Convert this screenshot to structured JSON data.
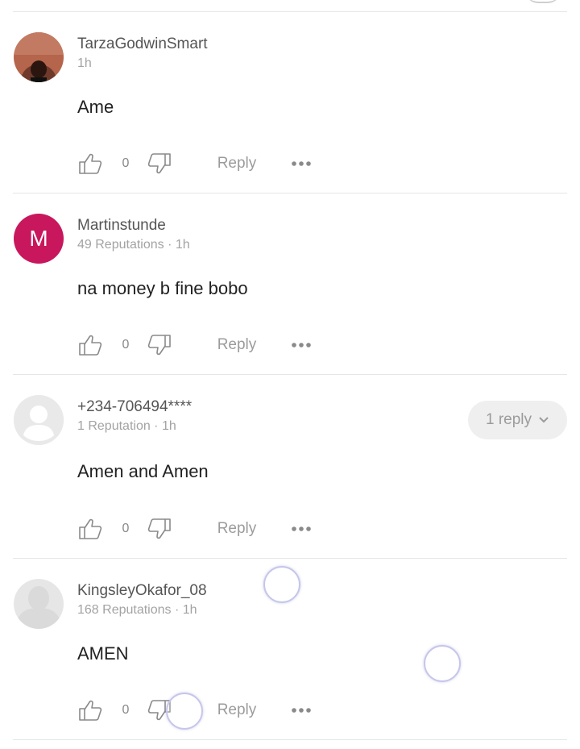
{
  "comments": [
    {
      "username": "TarzaGodwinSmart",
      "meta": "1h",
      "text": "Ame",
      "likes": "0",
      "reply_label": "Reply",
      "avatar": "photo"
    },
    {
      "username": "Martinstunde",
      "meta": "49 Reputations · 1h",
      "text": "na money b fine bobo",
      "likes": "0",
      "reply_label": "Reply",
      "avatar": "letter",
      "avatar_letter": "M",
      "avatar_color": "#c8175d"
    },
    {
      "username": "+234-706494****",
      "meta": "1 Reputation · 1h",
      "text": "Amen and Amen",
      "likes": "0",
      "reply_label": "Reply",
      "avatar": "default-user",
      "replies_button": "1 reply"
    },
    {
      "username": "KingsleyOkafor_08",
      "meta": "168 Reputations · 1h",
      "text": "AMEN",
      "likes": "0",
      "reply_label": "Reply",
      "avatar": "default-user"
    }
  ],
  "icons": {
    "like": "thumbs-up-icon",
    "dislike": "thumbs-down-icon",
    "more": "more-dots-icon",
    "expand": "chevron-down-icon"
  }
}
